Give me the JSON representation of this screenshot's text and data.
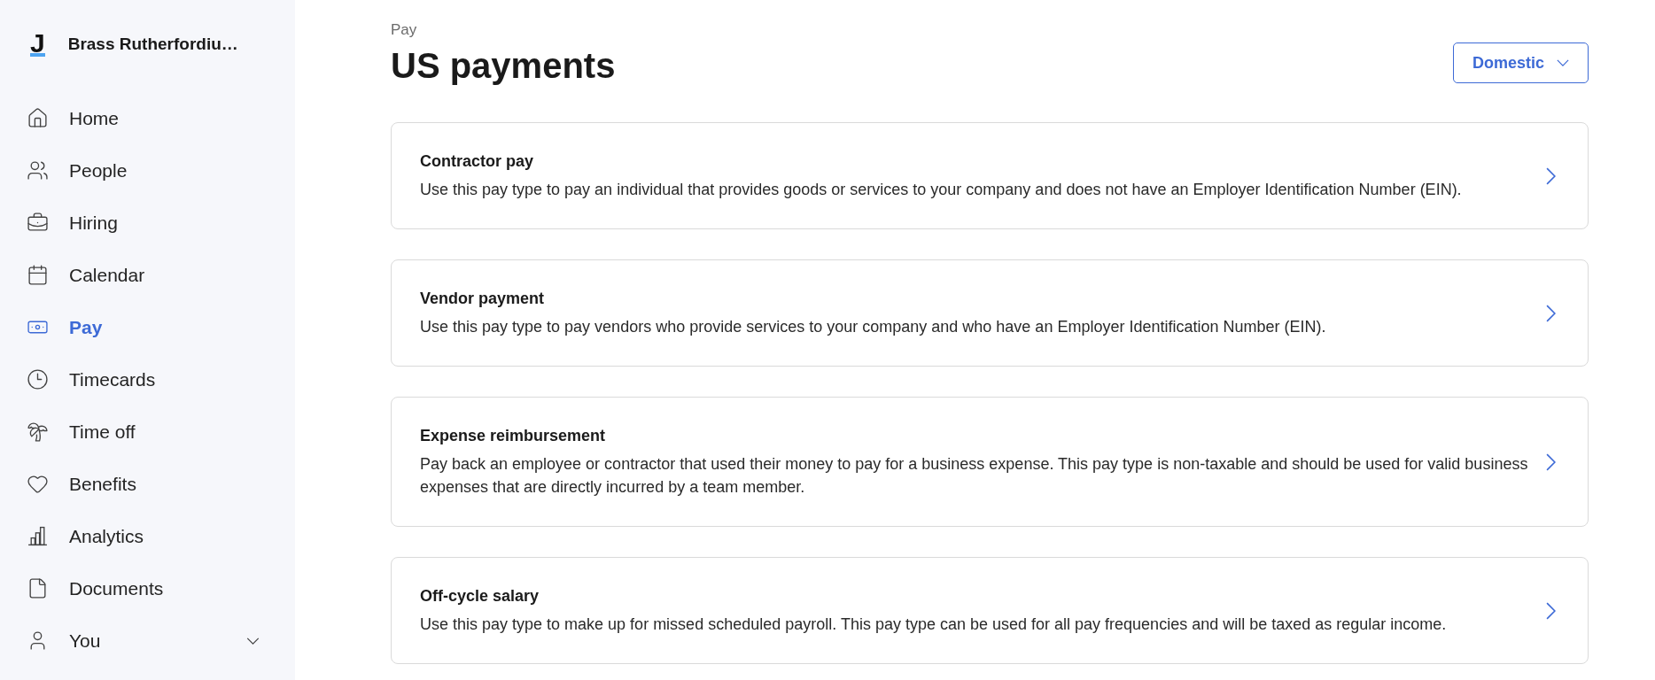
{
  "sidebar": {
    "brand": {
      "logo": "J",
      "name": "Brass Rutherfordiu…"
    },
    "items": [
      {
        "label": "Home",
        "selected": false
      },
      {
        "label": "People",
        "selected": false
      },
      {
        "label": "Hiring",
        "selected": false
      },
      {
        "label": "Calendar",
        "selected": false
      },
      {
        "label": "Pay",
        "selected": true
      },
      {
        "label": "Timecards",
        "selected": false
      },
      {
        "label": "Time off",
        "selected": false
      },
      {
        "label": "Benefits",
        "selected": false
      },
      {
        "label": "Analytics",
        "selected": false
      },
      {
        "label": "Documents",
        "selected": false
      }
    ],
    "account": {
      "label": "You",
      "expanded": false
    }
  },
  "header": {
    "breadcrumb": "Pay",
    "title": "US payments",
    "dropdown": {
      "value": "Domestic",
      "expanded": false
    }
  },
  "payment_types": [
    {
      "title": "Contractor pay",
      "description": "Use this pay type to pay an individual that provides goods or services to your company and does not have an Employer Identification Number (EIN)."
    },
    {
      "title": "Vendor payment",
      "description": "Use this pay type to pay vendors who provide services to your company and who have an Employer Identification Number (EIN)."
    },
    {
      "title": "Expense reimbursement",
      "description": "Pay back an employee or contractor that used their money to pay for a business expense. This pay type is non-taxable and should be used for valid business expenses that are directly incurred by a team member."
    },
    {
      "title": "Off-cycle salary",
      "description": "Use this pay type to make up for missed scheduled payroll. This pay type can be used for all pay frequencies and will be taxed as regular income."
    }
  ]
}
